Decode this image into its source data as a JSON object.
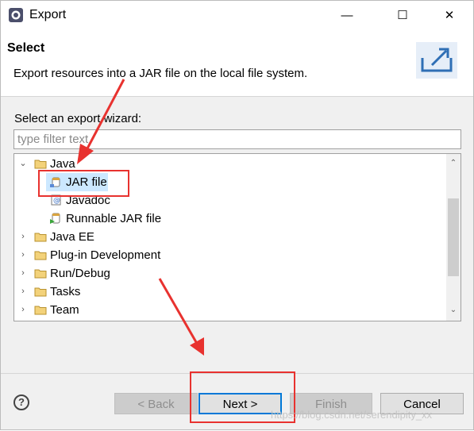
{
  "window": {
    "title": "Export",
    "minimize_glyph": "—",
    "maximize_glyph": "☐",
    "close_glyph": "✕"
  },
  "header": {
    "title": "Select",
    "description": "Export resources into a JAR file on the local file system."
  },
  "wizard": {
    "label": "Select an export wizard:",
    "filter_placeholder": "type filter text",
    "filter_value": ""
  },
  "tree": {
    "expanded_glyph": "⌄",
    "collapsed_glyph": "›",
    "items": [
      {
        "label": "Java",
        "icon": "folder-icon",
        "expanded": true
      },
      {
        "label": "JAR file",
        "icon": "jar-file-icon",
        "selected": true
      },
      {
        "label": "Javadoc",
        "icon": "javadoc-icon"
      },
      {
        "label": "Runnable JAR file",
        "icon": "runnable-jar-icon"
      },
      {
        "label": "Java EE",
        "icon": "folder-icon",
        "expanded": false
      },
      {
        "label": "Plug-in Development",
        "icon": "folder-icon",
        "expanded": false
      },
      {
        "label": "Run/Debug",
        "icon": "folder-icon",
        "expanded": false
      },
      {
        "label": "Tasks",
        "icon": "folder-icon",
        "expanded": false
      },
      {
        "label": "Team",
        "icon": "folder-icon",
        "expanded": false
      }
    ],
    "scroll_up_glyph": "⌃",
    "scroll_down_glyph": "⌄"
  },
  "footer": {
    "help_glyph": "?",
    "back_label": "< Back",
    "next_label": "Next >",
    "finish_label": "Finish",
    "cancel_label": "Cancel"
  },
  "watermark": "https://blog.csdn.net/serendipity_xx",
  "colors": {
    "annotation_red": "#e8322f",
    "selection_bg": "#cce8ff",
    "default_button_border": "#0078d7"
  }
}
